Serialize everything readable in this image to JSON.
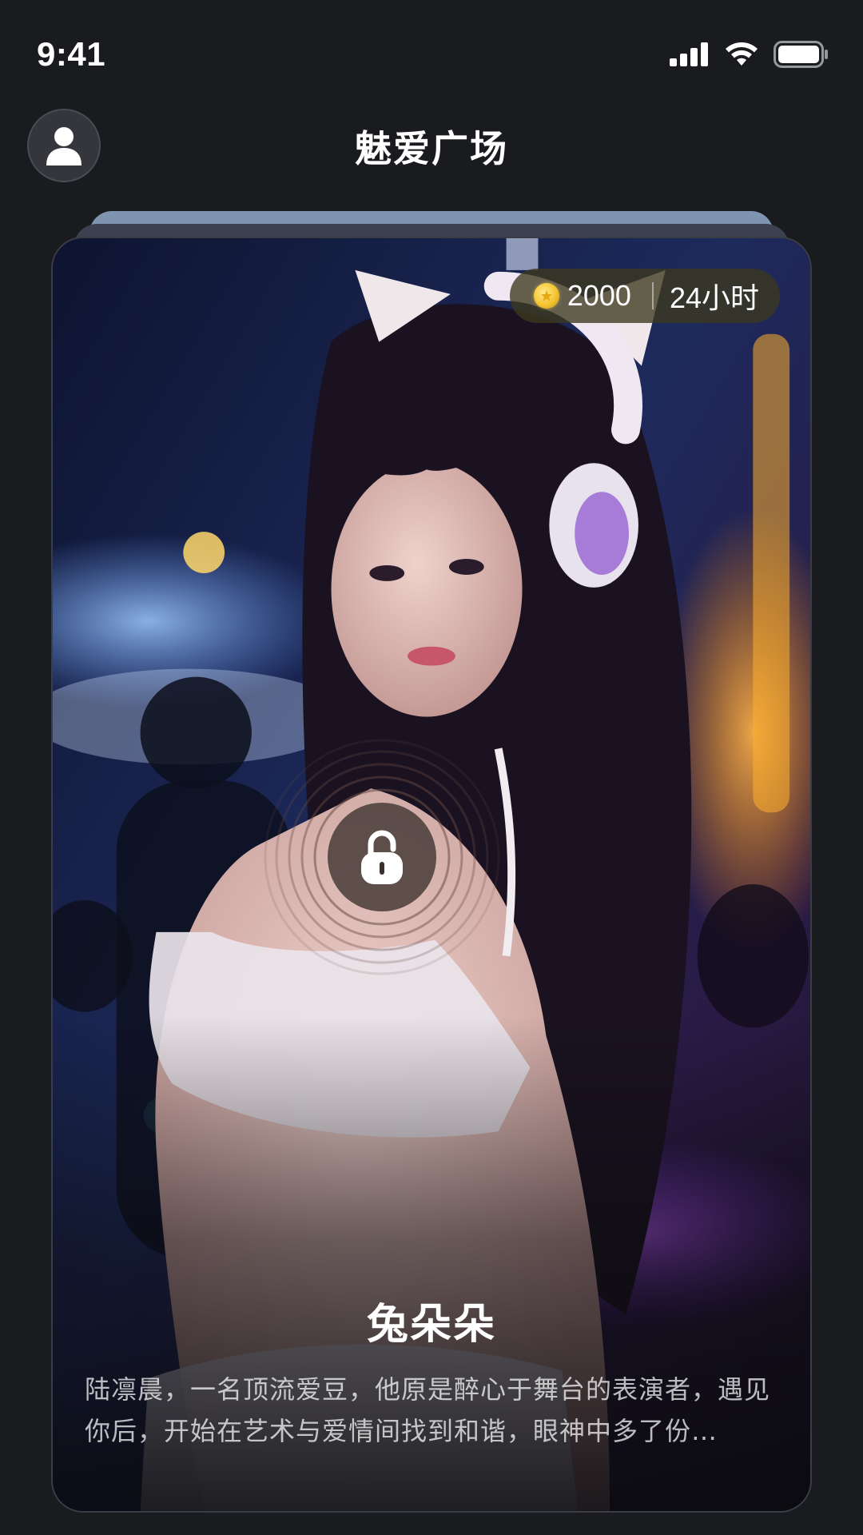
{
  "status_bar": {
    "time": "9:41"
  },
  "header": {
    "title": "魅爱广场"
  },
  "card": {
    "price": "2000",
    "duration": "24小时",
    "name": "兔朵朵",
    "description": "陆凛晨，一名顶流爱豆，他原是醉心于舞台的表演者，遇见你后，开始在艺术与爱情间找到和谐，眼神中多了份…"
  },
  "colors": {
    "background": "#1a1b1f",
    "pill_background": "#3c381e",
    "coin": "#f4c531"
  },
  "icons": [
    "signal-icon",
    "wifi-icon",
    "battery-icon",
    "user-icon",
    "coin-icon",
    "lock-icon"
  ]
}
